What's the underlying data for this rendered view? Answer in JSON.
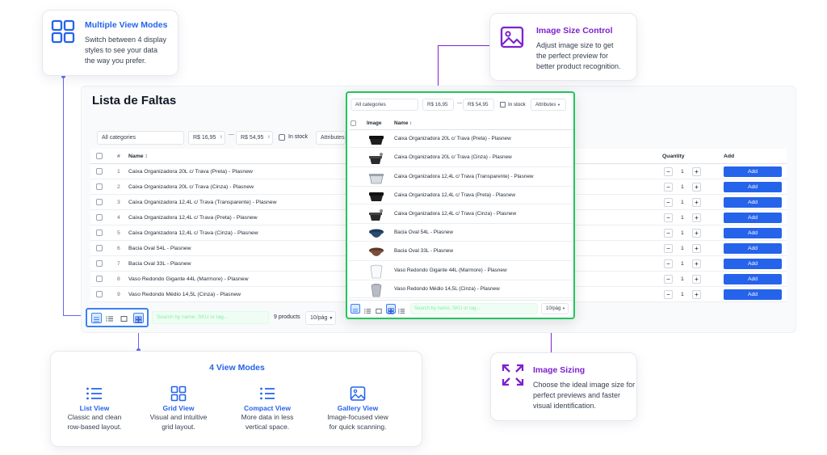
{
  "colors": {
    "accent_blue": "#2563eb",
    "accent_purple": "#7e22ce",
    "highlight_green": "#22c55e"
  },
  "callouts": {
    "multi_view": {
      "title": "Multiple View Modes",
      "text": [
        "Switch between 4 display",
        "styles to see your data",
        "the way you prefer."
      ],
      "icon": "grid-icon"
    },
    "image_size_control": {
      "title": "Image Size Control",
      "text": [
        "Adjust image size to get",
        "the perfect preview for",
        "better product recognition."
      ],
      "icon": "image-icon"
    },
    "image_sizing": {
      "title": "Image Sizing",
      "text": [
        "Choose the ideal image size for",
        "perfect previews and faster",
        "visual identification."
      ],
      "icon": "expand-icon"
    },
    "view_modes": {
      "title": "4 View Modes",
      "modes": [
        {
          "name": "List View",
          "lines": [
            "Classic and clean",
            "row-based layout."
          ],
          "icon": "list-icon"
        },
        {
          "name": "Grid View",
          "lines": [
            "Visual and intuitive",
            "grid layout."
          ],
          "icon": "grid-icon"
        },
        {
          "name": "Compact View",
          "lines": [
            "More data in less",
            "vertical space."
          ],
          "icon": "compact-list-icon"
        },
        {
          "name": "Gallery View",
          "lines": [
            "Image-focused view",
            "for quick scanning."
          ],
          "icon": "gallery-icon"
        }
      ]
    }
  },
  "main": {
    "title": "Lista de Faltas",
    "filters": {
      "category": "All categories",
      "price_min": "R$ 16,95",
      "price_sep": "—",
      "price_max": "R$ 54,95",
      "in_stock": "In stock",
      "attributes": "Attributes"
    },
    "columns": {
      "num": "#",
      "name": "Name ↕",
      "quantity": "Quantity",
      "add": "Add"
    },
    "rows": [
      {
        "num": "1",
        "name": "Caixa Organizadora 20L c/ Trava (Preta) - Plasnew",
        "qty": "1"
      },
      {
        "num": "2",
        "name": "Caixa Organizadora 20L c/ Trava (Cinza) - Plasnew",
        "qty": "1"
      },
      {
        "num": "3",
        "name": "Caixa Organizadora 12,4L c/ Trava (Transparente) - Plasnew",
        "qty": "1"
      },
      {
        "num": "4",
        "name": "Caixa Organizadora 12,4L c/ Trava (Preta) - Plasnew",
        "qty": "1"
      },
      {
        "num": "5",
        "name": "Caixa Organizadora 12,4L c/ Trava (Cinza) - Plasnew",
        "qty": "1"
      },
      {
        "num": "6",
        "name": "Bacia Oval 54L - Plasnew",
        "qty": "1"
      },
      {
        "num": "7",
        "name": "Bacia Oval 33L - Plasnew",
        "qty": "1"
      },
      {
        "num": "8",
        "name": "Vaso Redondo Gigante 44L (Marmore) - Plasnew",
        "qty": "1"
      },
      {
        "num": "9",
        "name": "Vaso Redondo Médio 14,5L (Cinza) - Plasnew",
        "qty": "1"
      }
    ],
    "add_label": "Add",
    "qty_minus": "−",
    "qty_plus": "+",
    "footer": {
      "search_placeholder": "Search by name, SKU or tag...",
      "count": "9 products",
      "per_page": "10/pág"
    }
  },
  "overlay": {
    "filters": {
      "category": "All categories",
      "price_min": "R$ 16,95",
      "price_sep": "—",
      "price_max": "R$ 54,95",
      "in_stock": "In stock",
      "attributes": "Attributes"
    },
    "columns": {
      "image": "Image",
      "name": "Name ↕"
    },
    "rows": [
      {
        "name": "Caixa Organizadora 20L c/ Trava (Preta) - Plasnew",
        "thumb": "black-box"
      },
      {
        "name": "Caixa Organizadora 20L c/ Trava (Cinza) - Plasnew",
        "thumb": "grey-box"
      },
      {
        "name": "Caixa Organizadora 12,4L c/ Trava (Transparente) - Plasnew",
        "thumb": "clear-box"
      },
      {
        "name": "Caixa Organizadora 12,4L c/ Trava (Preta) - Plasnew",
        "thumb": "black-box"
      },
      {
        "name": "Caixa Organizadora 12,4L c/ Trava (Cinza) - Plasnew",
        "thumb": "grey-box"
      },
      {
        "name": "Bacia Oval 54L - Plasnew",
        "thumb": "blue-basin"
      },
      {
        "name": "Bacia Oval 33L - Plasnew",
        "thumb": "brown-basin"
      },
      {
        "name": "Vaso Redondo Gigante 44L (Marmore) - Plasnew",
        "thumb": "white-pot"
      },
      {
        "name": "Vaso Redondo Médio 14,5L (Cinza) - Plasnew",
        "thumb": "grey-pot"
      }
    ],
    "footer": {
      "search_placeholder": "Search by name, SKU or tag...",
      "per_page": "10/pág"
    }
  }
}
